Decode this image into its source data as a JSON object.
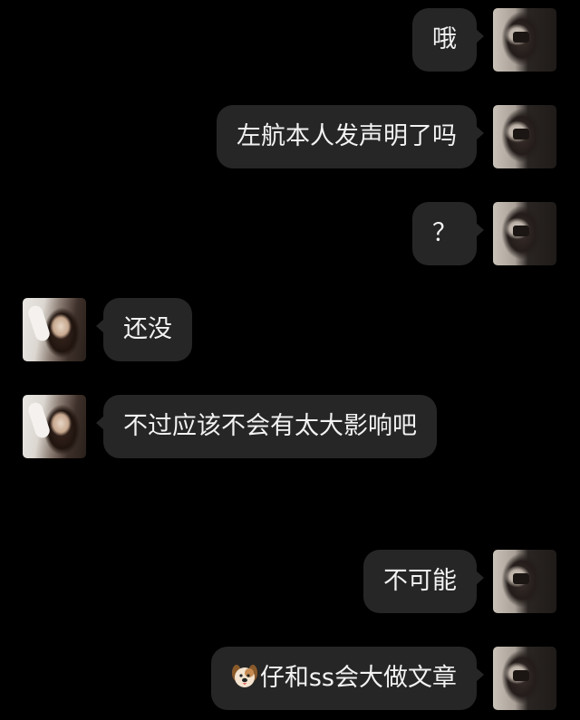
{
  "messages": [
    {
      "side": "right",
      "text": "哦",
      "avatar": "my-avatar"
    },
    {
      "side": "right",
      "text": "左航本人发声明了吗",
      "avatar": "my-avatar"
    },
    {
      "side": "right",
      "text": "？",
      "avatar": "my-avatar"
    },
    {
      "side": "left",
      "text": "还没",
      "avatar": "friend-avatar"
    },
    {
      "side": "left",
      "text": "不过应该不会有太大影响吧",
      "avatar": "friend-avatar"
    },
    {
      "side": "right",
      "text": "不可能",
      "avatar": "my-avatar"
    },
    {
      "side": "right",
      "text": "仔和ss会大做文章",
      "prefix_icon": "dog-face-icon",
      "avatar": "my-avatar"
    }
  ],
  "colors": {
    "background": "#000000",
    "bubble": "#262626",
    "text": "#f2f2f2"
  }
}
